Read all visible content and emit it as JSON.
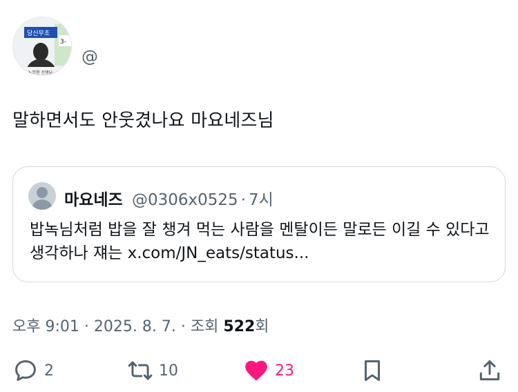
{
  "author": {
    "avatar_sign_text": "당신무초",
    "avatar_number": "3-",
    "avatar_caption": "노무현 선생님",
    "handle": "@"
  },
  "tweet": {
    "text": "말하면서도 안웃겼나요 마요네즈님"
  },
  "quote": {
    "name": "마요네즈",
    "handle": "@0306x0525",
    "separator": "·",
    "time": "7시",
    "text": "밥녹님처럼 밥을 잘 챙겨 먹는 사람을 멘탈이든 말로든 이길 수 있다고 생각하나 쟤는 x.com/JN_eats/status..."
  },
  "meta": {
    "time": "오후 9:01",
    "separator1": "·",
    "date": "2025. 8. 7.",
    "separator2": "·",
    "views_label": "조회",
    "views_count": "522",
    "views_suffix": "회"
  },
  "actions": {
    "replies": "2",
    "retweets": "10",
    "likes": "23"
  },
  "colors": {
    "like_pink": "#f91880",
    "muted_text": "#536471",
    "icon_dark": "#536471",
    "border": "#cfd9de"
  },
  "icons": {
    "reply": "reply-bubble-icon",
    "retweet": "retweet-arrows-icon",
    "like": "heart-filled-icon",
    "bookmark": "bookmark-icon",
    "share": "share-upload-icon"
  }
}
